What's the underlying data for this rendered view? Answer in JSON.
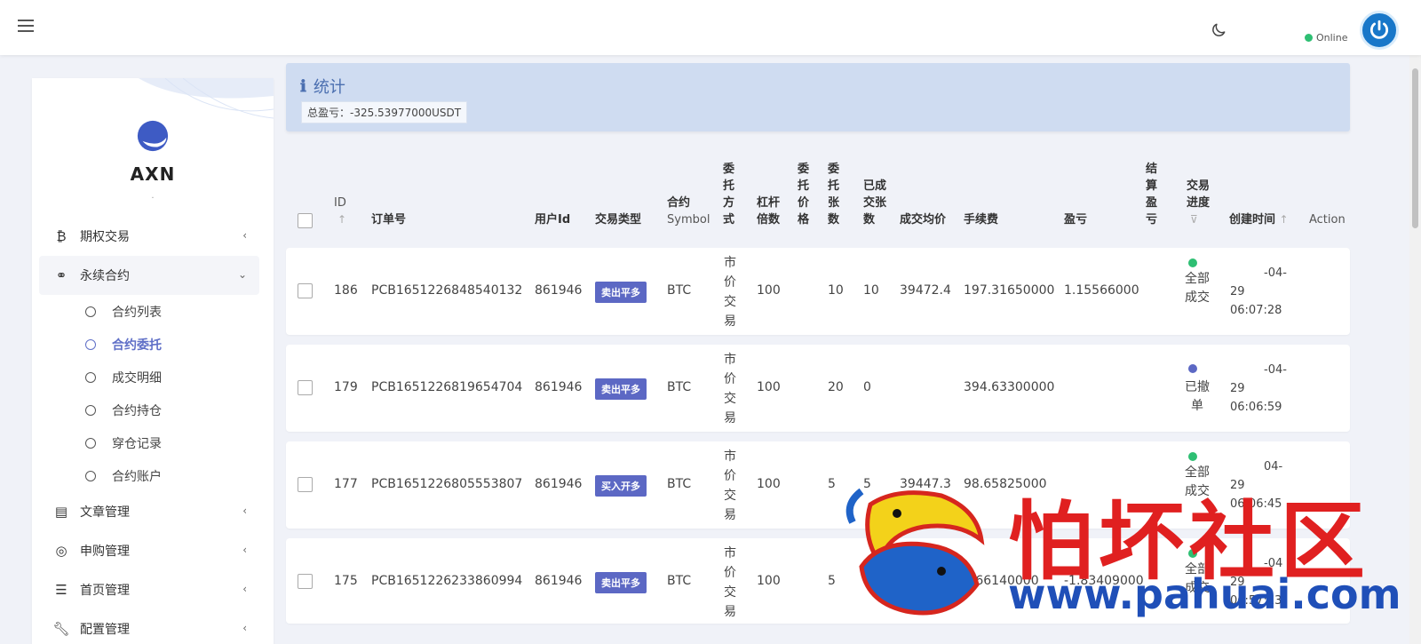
{
  "header": {
    "status_label": "Online",
    "status_color": "#2ebf73",
    "theme_icon": "moon-icon",
    "menu_icon": "hamburger-icon"
  },
  "sidebar": {
    "brand_name": "AXN",
    "brand_sub": "·",
    "items": [
      {
        "label": "期权交易",
        "icon": "bitcoin-icon"
      },
      {
        "label": "永续合约",
        "icon": "link-icon",
        "open": true,
        "children": [
          {
            "label": "合约列表"
          },
          {
            "label": "合约委托",
            "active": true
          },
          {
            "label": "成交明细"
          },
          {
            "label": "合约持仓"
          },
          {
            "label": "穿仓记录"
          },
          {
            "label": "合约账户"
          }
        ]
      },
      {
        "label": "文章管理",
        "icon": "newspaper-icon"
      },
      {
        "label": "申购管理",
        "icon": "lifebuoy-icon"
      },
      {
        "label": "首页管理",
        "icon": "list-icon"
      },
      {
        "label": "配置管理",
        "icon": "wrench-icon"
      }
    ]
  },
  "stats": {
    "title": "统计",
    "total_profit": "总盈亏：-325.53977000USDT"
  },
  "table": {
    "headers": {
      "id": "ID",
      "order_no": "订单号",
      "user_id": "用户Id",
      "trade_type": "交易类型",
      "symbol_1": "合约",
      "symbol_2": "Symbol",
      "entrust_way": "委托方式",
      "leverage_1": "杠杆",
      "leverage_2": "倍数",
      "entrust_price": "委托价格",
      "entrust_qty": "委托张数",
      "filled_qty_1": "已成",
      "filled_qty_2": "交张",
      "filled_qty_3": "数",
      "avg_price": "成交均价",
      "fee": "手续费",
      "pnl": "盈亏",
      "settle_pnl": "结算盈亏",
      "progress_1": "交易",
      "progress_2": "进度",
      "created": "创建时间",
      "action": "Action"
    },
    "rows": [
      {
        "id": "186",
        "order_no": "PCB1651226848540132",
        "user_id": "861946",
        "trade_type": "卖出平多",
        "symbol": "BTC",
        "entrust_way": "市价交易",
        "leverage": "100",
        "entrust_price": "",
        "entrust_qty": "10",
        "filled_qty": "10",
        "avg_price": "39472.4",
        "fee": "197.31650000",
        "pnl": "1.15566000",
        "settle_pnl": "",
        "status": "全部成交",
        "status_color": "#2ebf73",
        "date_1": "-04-",
        "date_2": "29",
        "date_3": "06:07:28"
      },
      {
        "id": "179",
        "order_no": "PCB1651226819654704",
        "user_id": "861946",
        "trade_type": "卖出平多",
        "symbol": "BTC",
        "entrust_way": "市价交易",
        "leverage": "100",
        "entrust_price": "",
        "entrust_qty": "20",
        "filled_qty": "0",
        "avg_price": "",
        "fee": "394.63300000",
        "pnl": "",
        "settle_pnl": "",
        "status": "已撤单",
        "status_color": "#5c68c4",
        "date_1": "-04-",
        "date_2": "29",
        "date_3": "06:06:59"
      },
      {
        "id": "177",
        "order_no": "PCB1651226805553807",
        "user_id": "861946",
        "trade_type": "买入开多",
        "symbol": "BTC",
        "entrust_way": "市价交易",
        "leverage": "100",
        "entrust_price": "",
        "entrust_qty": "5",
        "filled_qty": "5",
        "avg_price": "39447.3",
        "fee": "98.65825000",
        "pnl": "",
        "settle_pnl": "",
        "status": "全部成交",
        "status_color": "#2ebf73",
        "date_1": "04-",
        "date_2": "29",
        "date_3": "06:06:45"
      },
      {
        "id": "175",
        "order_no": "PCB1651226233860994",
        "user_id": "861946",
        "trade_type": "卖出平多",
        "symbol": "BTC",
        "entrust_way": "市价交易",
        "leverage": "100",
        "entrust_price": "",
        "entrust_qty": "5",
        "filled_qty": "",
        "avg_price": "",
        "fee": "8.66140000",
        "pnl": "-1.83409000",
        "settle_pnl": "",
        "status": "全部成交",
        "status_color": "#2ebf73",
        "date_1": "-04",
        "date_2": "29",
        "date_3": "06:57:13"
      }
    ]
  },
  "watermark": {
    "text": "怕坏社区",
    "url": "www.pahuai.com",
    "text_color": "#e02020",
    "url_color": "#1f4fb8"
  }
}
